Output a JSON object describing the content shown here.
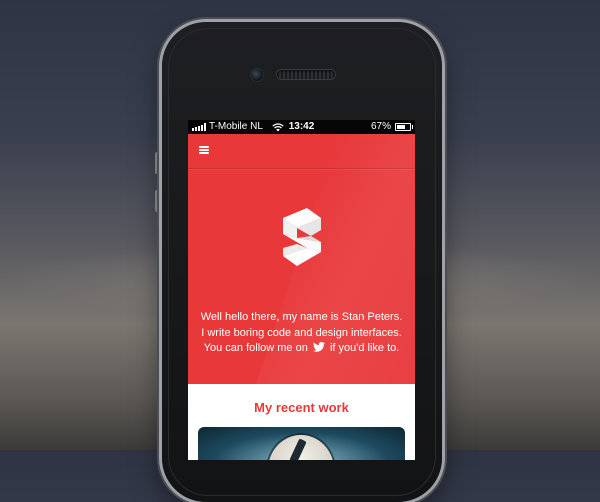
{
  "statusbar": {
    "carrier": "T-Mobile NL",
    "time": "13:42",
    "battery": "67%",
    "battery_level": 0.67
  },
  "hero": {
    "intro_line1": "Well hello there, my name is Stan Peters.",
    "intro_line2": "I write boring code and design interfaces.",
    "intro_line3_before": "You can follow me on",
    "intro_line3_after": "if you'd like to."
  },
  "work": {
    "title": "My recent work"
  },
  "colors": {
    "accent": "#e8383a",
    "background": "#ffffff"
  },
  "icons": [
    "menu-icon",
    "logo-s-icon",
    "twitter-icon",
    "wifi-icon",
    "signal-icon",
    "battery-icon"
  ]
}
